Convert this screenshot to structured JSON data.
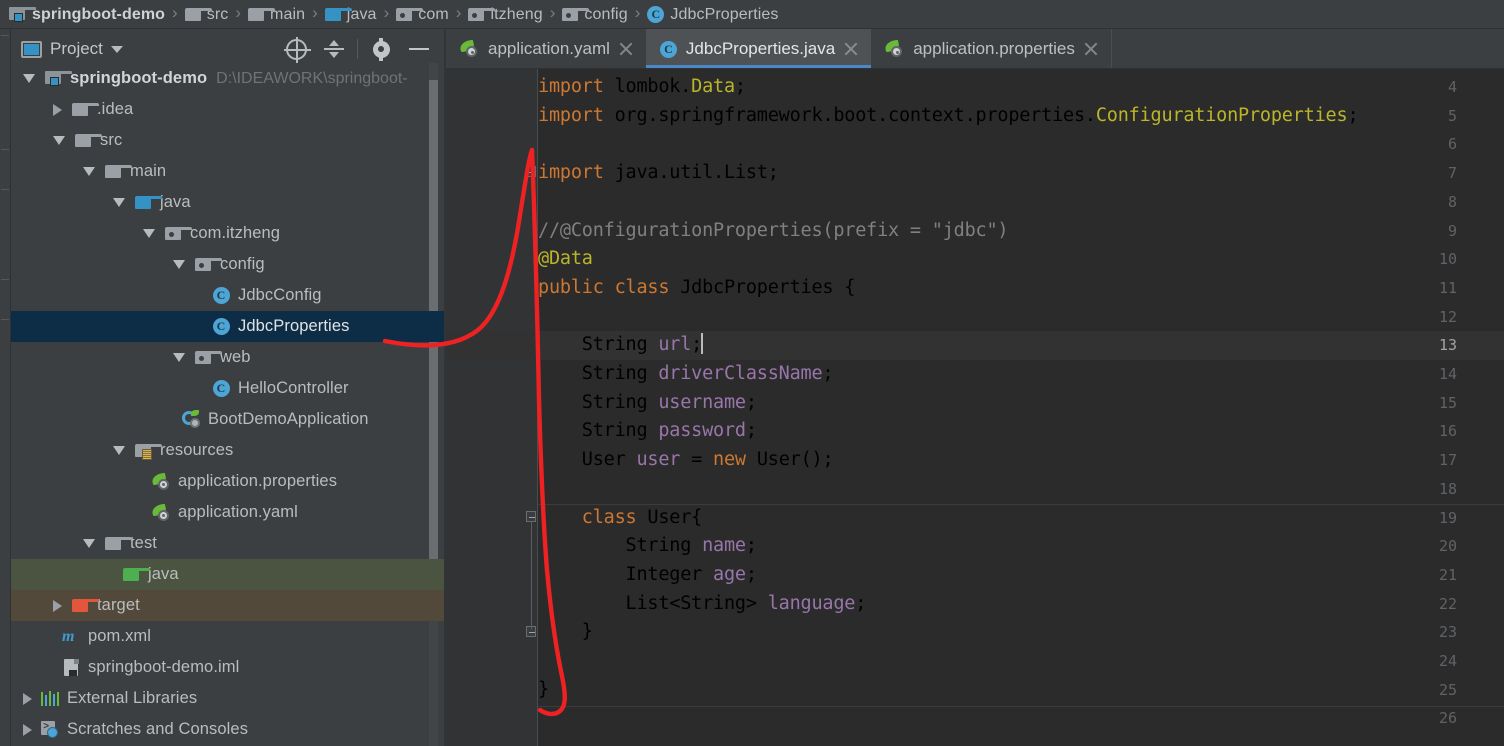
{
  "breadcrumb": {
    "items": [
      {
        "label": "springboot-demo",
        "icon": "module-icon"
      },
      {
        "label": "src",
        "icon": "folder-icon"
      },
      {
        "label": "main",
        "icon": "folder-icon"
      },
      {
        "label": "java",
        "icon": "folder-blue-icon"
      },
      {
        "label": "com",
        "icon": "package-icon"
      },
      {
        "label": "itzheng",
        "icon": "package-icon"
      },
      {
        "label": "config",
        "icon": "package-icon"
      },
      {
        "label": "JdbcProperties",
        "icon": "java-class-icon"
      }
    ],
    "separator": "›"
  },
  "project_panel": {
    "title": "Project",
    "dropdown_caret": "▾",
    "actions": [
      {
        "name": "locate-file",
        "icon": "crosshair-icon"
      },
      {
        "name": "collapse-all",
        "icon": "collapse-all-icon"
      },
      {
        "name": "settings",
        "icon": "gear-icon"
      },
      {
        "name": "hide",
        "icon": "minus-icon"
      }
    ],
    "tree": [
      {
        "label": "springboot-demo",
        "path": "D:\\IDEAWORK\\springboot-",
        "indent": 0,
        "arrow": "down",
        "icon": "module-icon",
        "bold": true,
        "state": "normal"
      },
      {
        "label": ".idea",
        "path": "",
        "indent": 1,
        "arrow": "right",
        "icon": "folder-icon",
        "bold": false,
        "state": "normal"
      },
      {
        "label": "src",
        "path": "",
        "indent": 1,
        "arrow": "down",
        "icon": "folder-icon",
        "bold": false,
        "state": "normal"
      },
      {
        "label": "main",
        "path": "",
        "indent": 2,
        "arrow": "down",
        "icon": "folder-icon",
        "bold": false,
        "state": "normal"
      },
      {
        "label": "java",
        "path": "",
        "indent": 3,
        "arrow": "down",
        "icon": "folder-blue-icon",
        "bold": false,
        "state": "normal"
      },
      {
        "label": "com.itzheng",
        "path": "",
        "indent": 4,
        "arrow": "down",
        "icon": "package-icon",
        "bold": false,
        "state": "normal"
      },
      {
        "label": "config",
        "path": "",
        "indent": 5,
        "arrow": "down",
        "icon": "package-icon",
        "bold": false,
        "state": "normal"
      },
      {
        "label": "JdbcConfig",
        "path": "",
        "indent": 6,
        "arrow": "none",
        "icon": "java-class-icon",
        "bold": false,
        "state": "normal"
      },
      {
        "label": "JdbcProperties",
        "path": "",
        "indent": 6,
        "arrow": "none",
        "icon": "java-class-icon",
        "bold": false,
        "state": "selected"
      },
      {
        "label": "web",
        "path": "",
        "indent": 5,
        "arrow": "down",
        "icon": "package-icon",
        "bold": false,
        "state": "normal"
      },
      {
        "label": "HelloController",
        "path": "",
        "indent": 6,
        "arrow": "none",
        "icon": "java-class-icon",
        "bold": false,
        "state": "normal"
      },
      {
        "label": "BootDemoApplication",
        "path": "",
        "indent": 5,
        "arrow": "none",
        "icon": "spring-boot-icon",
        "bold": false,
        "state": "normal"
      },
      {
        "label": "resources",
        "path": "",
        "indent": 3,
        "arrow": "down",
        "icon": "resources-folder-icon",
        "bold": false,
        "state": "normal"
      },
      {
        "label": "application.properties",
        "path": "",
        "indent": 4,
        "arrow": "none",
        "icon": "spring-config-icon",
        "bold": false,
        "state": "normal"
      },
      {
        "label": "application.yaml",
        "path": "",
        "indent": 4,
        "arrow": "none",
        "icon": "spring-config-icon",
        "bold": false,
        "state": "normal"
      },
      {
        "label": "test",
        "path": "",
        "indent": 2,
        "arrow": "down",
        "icon": "folder-icon",
        "bold": false,
        "state": "normal"
      },
      {
        "label": "java",
        "path": "",
        "indent": 3,
        "arrow": "none",
        "icon": "folder-green-icon",
        "bold": false,
        "state": "test-source"
      },
      {
        "label": "target",
        "path": "",
        "indent": 1,
        "arrow": "right",
        "icon": "folder-orange-icon",
        "bold": false,
        "state": "excluded"
      },
      {
        "label": "pom.xml",
        "path": "",
        "indent": 1,
        "arrow": "none",
        "icon": "maven-icon",
        "bold": false,
        "state": "normal"
      },
      {
        "label": "springboot-demo.iml",
        "path": "",
        "indent": 1,
        "arrow": "none",
        "icon": "iml-file-icon",
        "bold": false,
        "state": "normal"
      },
      {
        "label": "External Libraries",
        "path": "",
        "indent": 0,
        "arrow": "right",
        "icon": "libraries-icon",
        "bold": false,
        "state": "normal"
      },
      {
        "label": "Scratches and Consoles",
        "path": "",
        "indent": 0,
        "arrow": "right",
        "icon": "scratches-icon",
        "bold": false,
        "state": "normal"
      }
    ]
  },
  "editor_tabs": [
    {
      "label": "application.yaml",
      "icon": "spring-config-icon",
      "active": false,
      "close": "×"
    },
    {
      "label": "JdbcProperties.java",
      "icon": "java-class-icon",
      "active": true,
      "close": "×"
    },
    {
      "label": "application.properties",
      "icon": "spring-config-icon",
      "active": false,
      "close": "×"
    }
  ],
  "editor": {
    "file": "JdbcProperties.java",
    "current_line": 13,
    "first_visible_line": 4,
    "last_visible_line": 26,
    "line_numbers": [
      4,
      5,
      6,
      7,
      8,
      9,
      10,
      11,
      12,
      13,
      14,
      15,
      16,
      17,
      18,
      19,
      20,
      21,
      22,
      23,
      24,
      25,
      26
    ],
    "lines": {
      "4": "import lombok.Data;",
      "5": "import org.springframework.boot.context.properties.ConfigurationProperties;",
      "6": "",
      "7": "import java.util.List;",
      "8": "",
      "9": "//@ConfigurationProperties(prefix = \"jdbc\")",
      "10": "@Data",
      "11": "public class JdbcProperties {",
      "12": "",
      "13": "    String url;",
      "14": "    String driverClassName;",
      "15": "    String username;",
      "16": "    String password;",
      "17": "    User user = new User();",
      "18": "",
      "19": "    class User{",
      "20": "        String name;",
      "21": "        Integer age;",
      "22": "        List<String> language;",
      "23": "    }",
      "24": "",
      "25": "}",
      "26": ""
    }
  },
  "annotation": {
    "type": "freehand-red-ink",
    "color": "#ee2222",
    "description": "hand-drawn red curve from JdbcProperties tree node up to line 7 then down the class body to closing brace on line 25"
  },
  "colors": {
    "editor_background": "#2b2b2b",
    "gutter_background": "#313335",
    "panel_background": "#3c3f41",
    "current_line": "#323232",
    "tree_selection": "#0d2c45",
    "tab_active": "#4e5254",
    "tab_underline": "#4a88c7",
    "keyword": "#cc7832",
    "annotation_kw": "#bbb529",
    "field": "#9876aa",
    "comment": "#808080",
    "text": "#a9b7c6",
    "test_source_row": "#4b5441",
    "excluded_row": "#53493b",
    "annotation_ink": "#ee2222"
  }
}
